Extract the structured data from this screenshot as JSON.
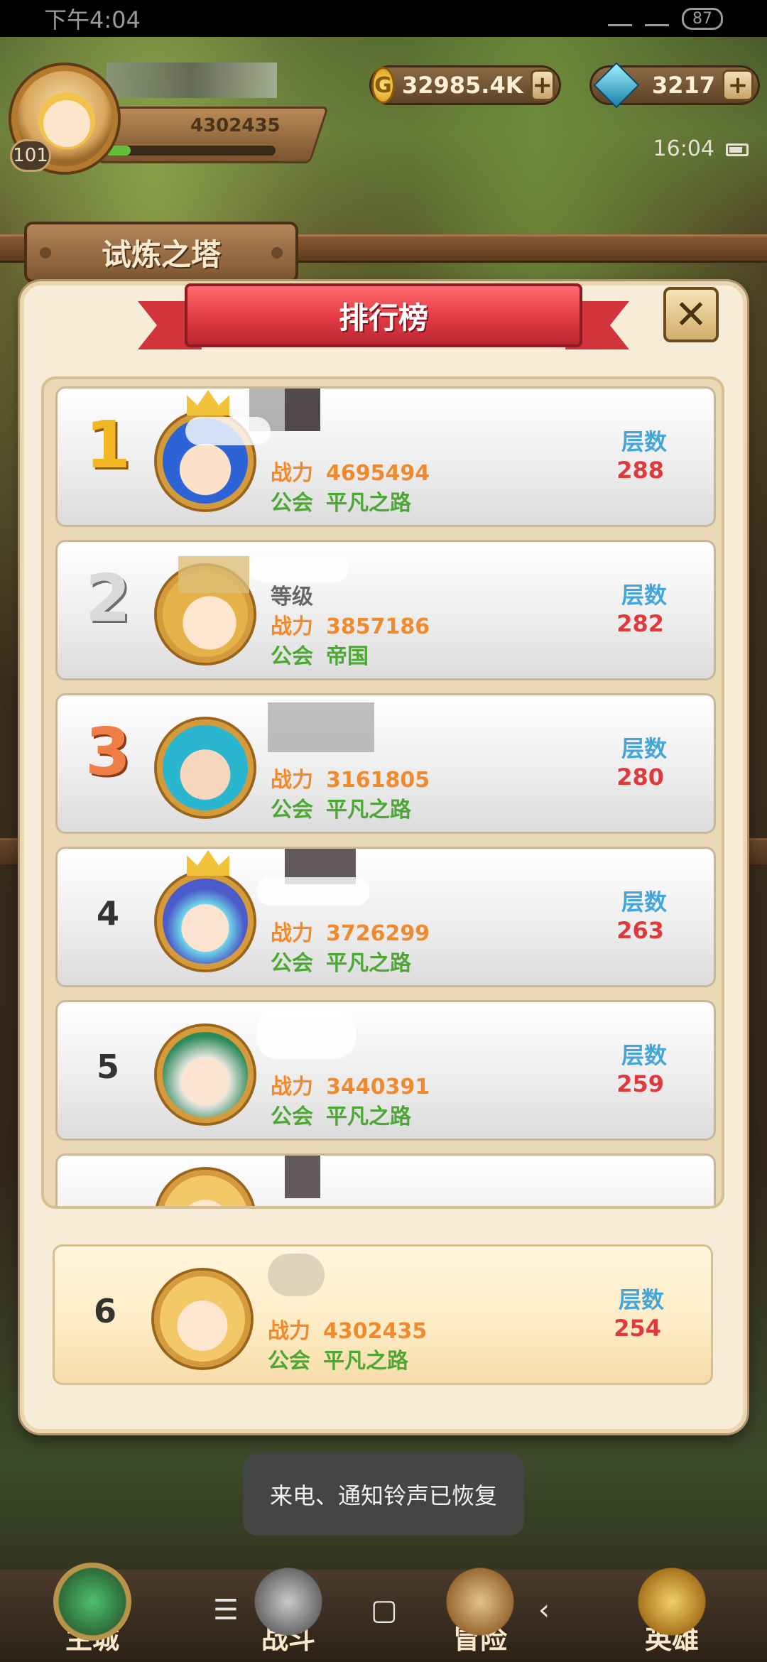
{
  "status_bar": {
    "time": "下午4:04",
    "battery": "87"
  },
  "hud": {
    "player_level": "101",
    "player_power": "4302435",
    "exp_progress": 0.15,
    "gold": "32985.4K",
    "gems": "3217",
    "clock": "16:04",
    "coin_glyph": "G",
    "plus": "+"
  },
  "screen_title": "试炼之塔",
  "modal": {
    "title": "排行榜",
    "close_glyph": "✕",
    "floor_label": "层数",
    "power_label": "战力",
    "guild_label": "公会",
    "level_label": "等级"
  },
  "rankings": [
    {
      "rank": "1",
      "power": "4695494",
      "guild": "平凡之路",
      "floors": "288",
      "portrait": "blue-hair-hero"
    },
    {
      "rank": "2",
      "power": "3857186",
      "guild": "帝国",
      "floors": "282",
      "portrait": "blonde-hero"
    },
    {
      "rank": "3",
      "power": "3161805",
      "guild": "平凡之路",
      "floors": "280",
      "portrait": "teal-hair-hero"
    },
    {
      "rank": "4",
      "power": "3726299",
      "guild": "平凡之路",
      "floors": "263",
      "portrait": "ice-hero"
    },
    {
      "rank": "5",
      "power": "3440391",
      "guild": "平凡之路",
      "floors": "259",
      "portrait": "white-hair-hero"
    }
  ],
  "self_rank": {
    "rank": "6",
    "power": "4302435",
    "guild": "平凡之路",
    "floors": "254",
    "portrait": "blonde-hero"
  },
  "toast": "来电、通知铃声已恢复",
  "bottom_nav": [
    "主城",
    "战斗",
    "冒险",
    "英雄"
  ],
  "system_nav": {
    "menu": "☰",
    "home": "▢",
    "back": "‹"
  },
  "colors": {
    "power": "#ef8a2e",
    "guild": "#4ca832",
    "floor_label": "#44a6d8",
    "floor_value": "#e0393b",
    "ribbon": "#e23a44"
  }
}
